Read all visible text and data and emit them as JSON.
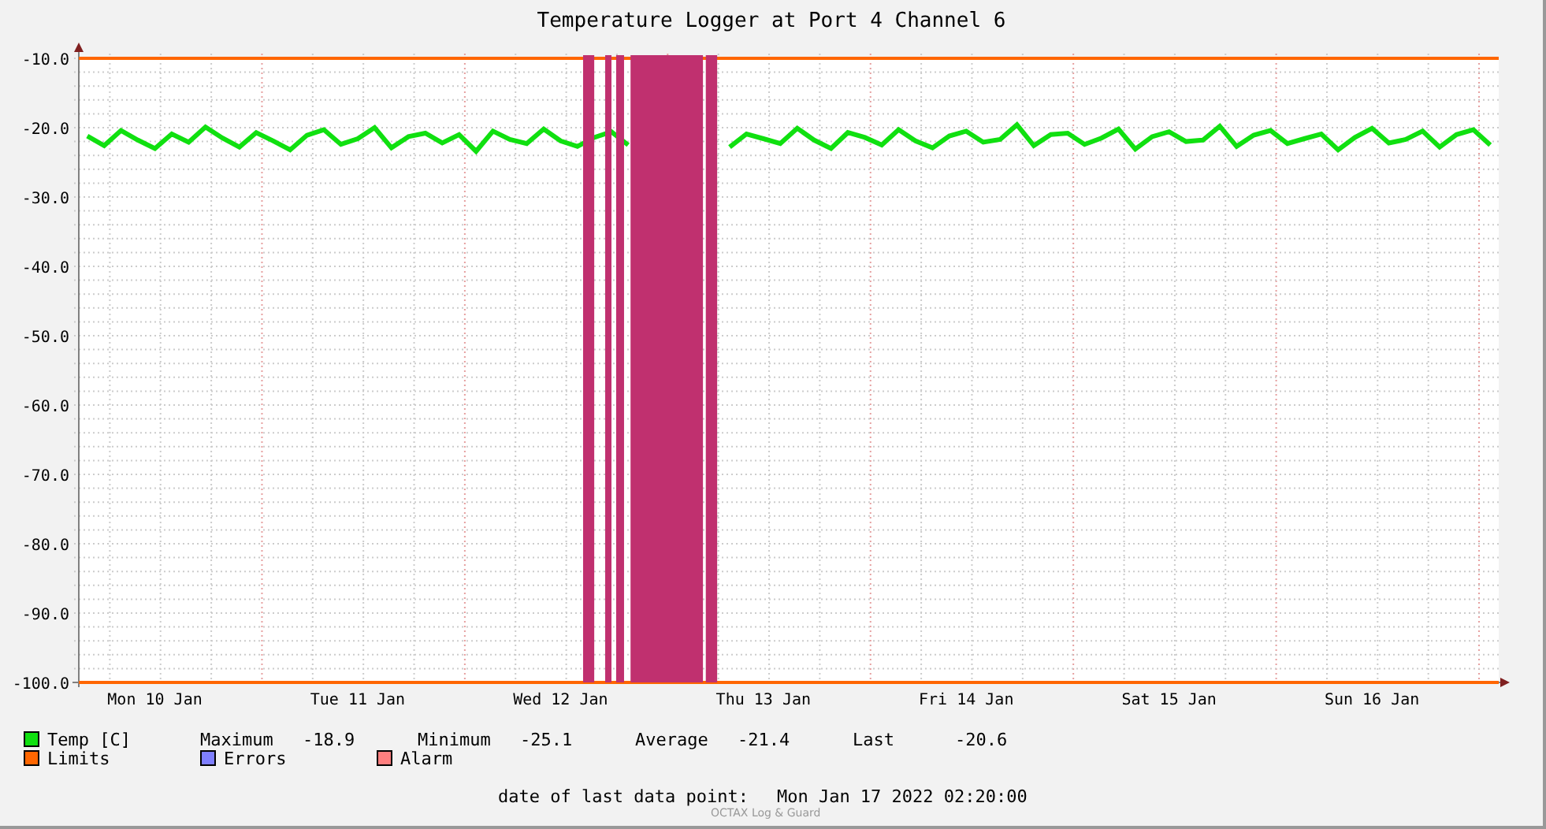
{
  "chart_data": {
    "type": "line",
    "title": "Temperature Logger at Port 4 Channel 6",
    "categories": [
      null,
      null,
      null,
      null,
      "Mon 10 Jan",
      null,
      null,
      null,
      null,
      null,
      null,
      null,
      null,
      null,
      null,
      null,
      "Tue 11 Jan",
      null,
      null,
      null,
      null,
      null,
      null,
      null,
      null,
      null,
      null,
      null,
      "Wed 12 Jan",
      null,
      null,
      null,
      null,
      null,
      null,
      null,
      null,
      null,
      null,
      null,
      "Thu 13 Jan",
      null,
      null,
      null,
      null,
      null,
      null,
      null,
      null,
      null,
      null,
      null,
      "Fri 14 Jan",
      null,
      null,
      null,
      null,
      null,
      null,
      null,
      null,
      null,
      null,
      null,
      "Sat 15 Jan",
      null,
      null,
      null,
      null,
      null,
      null,
      null,
      null,
      null,
      null,
      null,
      "Sun 16 Jan",
      null,
      null,
      null,
      null,
      null,
      null,
      null
    ],
    "series": [
      {
        "name": "Temp [C]",
        "color": "#10e010",
        "values": [
          -21.2,
          -22.6,
          -20.4,
          -21.8,
          -23.0,
          -20.9,
          -22.1,
          -19.9,
          -21.5,
          -22.8,
          -20.7,
          -21.9,
          -23.2,
          -21.1,
          -20.3,
          -22.4,
          -21.6,
          -20.0,
          -22.9,
          -21.3,
          -20.8,
          -22.2,
          -21.0,
          -23.4,
          -20.5,
          -21.7,
          -22.3,
          -20.2,
          -21.9,
          -22.7,
          -21.4,
          -20.6,
          -22.5,
          null,
          null,
          null,
          null,
          null,
          -22.8,
          -20.9,
          -21.6,
          -22.3,
          -20.1,
          -21.8,
          -23.0,
          -20.7,
          -21.4,
          -22.5,
          -20.3,
          -21.9,
          -22.9,
          -21.2,
          -20.5,
          -22.1,
          -21.7,
          -19.6,
          -22.6,
          -21.0,
          -20.8,
          -22.4,
          -21.5,
          -20.2,
          -23.1,
          -21.3,
          -20.6,
          -22.0,
          -21.8,
          -19.8,
          -22.7,
          -21.1,
          -20.4,
          -22.3,
          -21.6,
          -20.9,
          -23.2,
          -21.4,
          -20.1,
          -22.2,
          -21.7,
          -20.5,
          -22.8,
          -21.0,
          -20.3,
          -22.5
        ]
      }
    ],
    "ylim": [
      -100,
      -10
    ],
    "grid": true,
    "yticks": [
      {
        "value": -10,
        "label": "-10.0"
      },
      {
        "value": -20,
        "label": "-20.0"
      },
      {
        "value": -30,
        "label": "-30.0"
      },
      {
        "value": -40,
        "label": "-40.0"
      },
      {
        "value": -50,
        "label": "-50.0"
      },
      {
        "value": -60,
        "label": "-60.0"
      },
      {
        "value": -70,
        "label": "-70.0"
      },
      {
        "value": -80,
        "label": "-80.0"
      },
      {
        "value": -90,
        "label": "-90.0"
      },
      {
        "value": -100,
        "label": "-100.0"
      }
    ]
  },
  "limit_lines": [
    {
      "color": "#ff6600"
    },
    {
      "color": "#ff6600"
    }
  ],
  "alarm_bands": {
    "color": "#c0306f"
  },
  "stats": [
    {
      "label": "Maximum",
      "value": "-18.9"
    },
    {
      "label": "Minimum",
      "value": "-25.1"
    },
    {
      "label": "Average",
      "value": "-21.4"
    },
    {
      "label": "Last",
      "value": "-20.6"
    }
  ],
  "legend": [
    {
      "name": "Limits",
      "color": "#ff6600"
    },
    {
      "name": "Errors",
      "color": "#7f7fff"
    },
    {
      "name": "Alarm",
      "color": "#ff7f7f"
    }
  ],
  "footer": {
    "label": "date of last data point:",
    "value": "Mon Jan 17 2022 02:20:00",
    "credit": "OCTAX Log & Guard"
  }
}
